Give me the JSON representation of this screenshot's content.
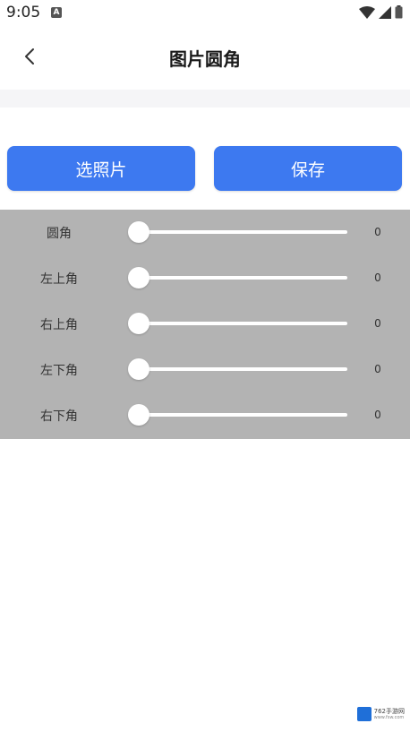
{
  "status_bar": {
    "time": "9:05",
    "app_icon_letter": "A"
  },
  "header": {
    "title": "图片圆角",
    "back_icon": "chevron-left-icon"
  },
  "buttons": {
    "select_photo": "选照片",
    "save": "保存"
  },
  "sliders": [
    {
      "label": "圆角",
      "value": "0",
      "fraction": 0
    },
    {
      "label": "左上角",
      "value": "0",
      "fraction": 0
    },
    {
      "label": "右上角",
      "value": "0",
      "fraction": 0
    },
    {
      "label": "左下角",
      "value": "0",
      "fraction": 0
    },
    {
      "label": "右下角",
      "value": "0",
      "fraction": 0
    }
  ],
  "colors": {
    "accent": "#3d79f0",
    "panel_bg": "#b3b3b3"
  },
  "watermark": {
    "title": "762手游网",
    "subtitle": "www.fsw.com"
  }
}
